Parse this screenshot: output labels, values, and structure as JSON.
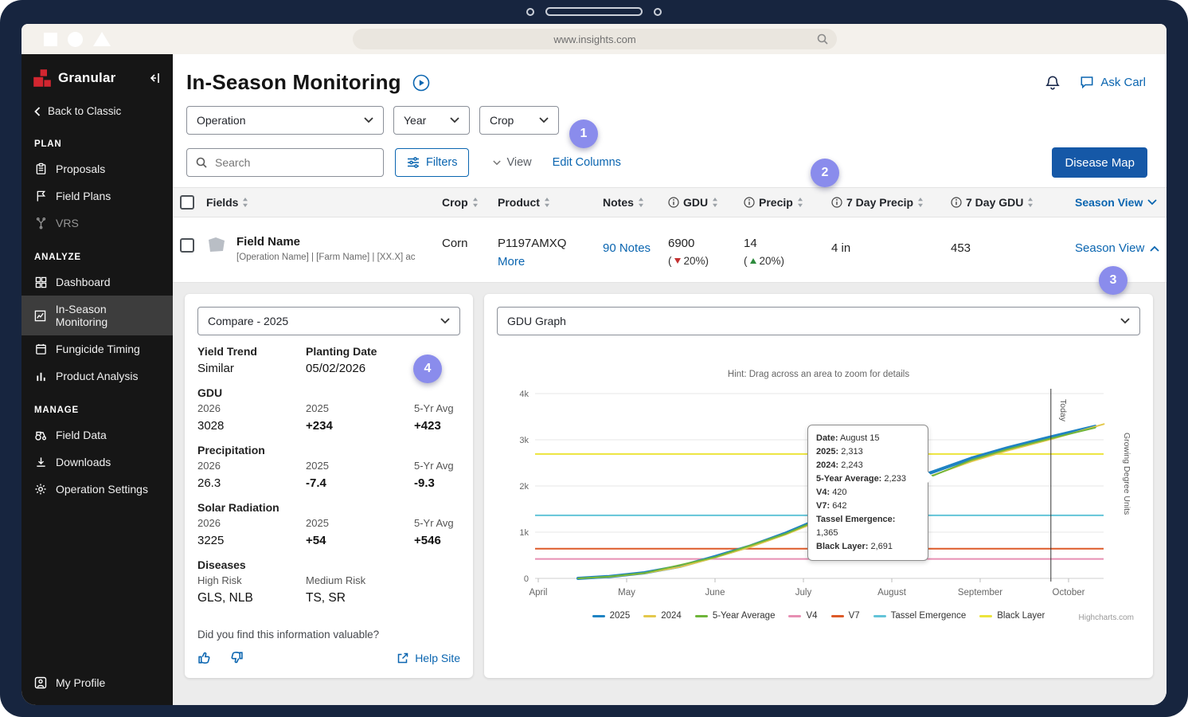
{
  "browser": {
    "url": "www.insights.com"
  },
  "sidebar": {
    "brand": "Granular",
    "back_label": "Back to Classic",
    "section_plan": "PLAN",
    "section_analyze": "ANALYZE",
    "section_manage": "MANAGE",
    "items": {
      "proposals": "Proposals",
      "field_plans": "Field Plans",
      "vrs": "VRS",
      "dashboard": "Dashboard",
      "in_season": "In-Season Monitoring",
      "fungicide": "Fungicide Timing",
      "product_analysis": "Product Analysis",
      "field_data": "Field Data",
      "downloads": "Downloads",
      "operation_settings": "Operation Settings",
      "my_profile": "My Profile"
    }
  },
  "header": {
    "title": "In-Season Monitoring",
    "ask_carl": "Ask Carl"
  },
  "toolbar": {
    "operation": "Operation",
    "year": "Year",
    "crop": "Crop",
    "search_placeholder": "Search",
    "filters": "Filters",
    "view": "View",
    "edit_columns": "Edit Columns",
    "disease_map": "Disease Map"
  },
  "callouts": {
    "one": "1",
    "two": "2",
    "three": "3",
    "four": "4"
  },
  "table": {
    "headers": {
      "fields": "Fields",
      "crop": "Crop",
      "product": "Product",
      "notes": "Notes",
      "gdu": "GDU",
      "precip": "Precip",
      "seven_day_precip": "7 Day Precip",
      "seven_day_gdu": "7 Day GDU",
      "season_view": "Season View"
    },
    "row": {
      "field_name": "Field Name",
      "field_meta": "[Operation Name] | [Farm Name] | [XX.X] ac",
      "crop": "Corn",
      "product": "P1197AMXQ",
      "more": "More",
      "notes": "90 Notes",
      "gdu_value": "6900",
      "paren": "(",
      "gdu_delta": "20%)",
      "precip_value": "14",
      "precip_delta": "20%)",
      "seven_day_precip": "4 in",
      "seven_day_gdu": "453",
      "season_view": "Season View"
    }
  },
  "detail": {
    "compare_select": "Compare - 2025",
    "yield_trend": {
      "label": "Yield Trend",
      "value": "Similar"
    },
    "planting_date": {
      "label": "Planting Date",
      "value": "05/02/2026"
    },
    "col_2026": "2026",
    "col_2025": "2025",
    "col_avg": "5-Yr Avg",
    "gdu": {
      "label": "GDU",
      "v2026": "3028",
      "v2025": "+234",
      "avg": "+423"
    },
    "precipitation": {
      "label": "Precipitation",
      "v2026": "26.3",
      "v2025": "-7.4",
      "avg": "-9.3"
    },
    "solar": {
      "label": "Solar Radiation",
      "v2026": "3225",
      "v2025": "+54",
      "avg": "+546"
    },
    "diseases": {
      "label": "Diseases",
      "high_label": "High Risk",
      "high_value": "GLS, NLB",
      "medium_label": "Medium Risk",
      "medium_value": "TS, SR"
    },
    "feedback_prompt": "Did you find this information valuable?",
    "help_site": "Help Site"
  },
  "chart_data": {
    "type": "line",
    "select_label": "GDU Graph",
    "hint": "Hint: Drag across an area to zoom for details",
    "ylabel": "Growing Degree Units",
    "credit": "Highcharts.com",
    "ylim": [
      0,
      4000
    ],
    "y_ticks": [
      {
        "label": "0",
        "value": 0
      },
      {
        "label": "1k",
        "value": 1000
      },
      {
        "label": "2k",
        "value": 2000
      },
      {
        "label": "3k",
        "value": 3000
      },
      {
        "label": "4k",
        "value": 4000
      }
    ],
    "x_ticks": [
      {
        "label": "April",
        "month": 0
      },
      {
        "label": "May",
        "month": 1
      },
      {
        "label": "June",
        "month": 2
      },
      {
        "label": "July",
        "month": 3
      },
      {
        "label": "August",
        "month": 4
      },
      {
        "label": "September",
        "month": 5
      },
      {
        "label": "October",
        "month": 6
      }
    ],
    "today": {
      "label": "Today",
      "month": 5.8
    },
    "hlines": [
      {
        "name": "V4",
        "value": 420,
        "color": "#e78fb3"
      },
      {
        "name": "V7",
        "value": 642,
        "color": "#dd5a28"
      },
      {
        "name": "Tassel Emergence",
        "value": 1365,
        "color": "#63c4d8"
      },
      {
        "name": "Black Layer",
        "value": 2691,
        "color": "#ece43b"
      }
    ],
    "curves": [
      {
        "name": "2025",
        "color": "#1f83c3",
        "width": 4,
        "points": [
          [
            0.45,
            0
          ],
          [
            0.8,
            40
          ],
          [
            1.2,
            120
          ],
          [
            1.6,
            260
          ],
          [
            2,
            470
          ],
          [
            2.4,
            700
          ],
          [
            2.8,
            980
          ],
          [
            3.2,
            1300
          ],
          [
            3.6,
            1650
          ],
          [
            4,
            2000
          ],
          [
            4.48,
            2313
          ],
          [
            4.9,
            2600
          ],
          [
            5.3,
            2820
          ],
          [
            5.8,
            3060
          ],
          [
            6.3,
            3290
          ]
        ]
      },
      {
        "name": "2024",
        "color": "#e3c84c",
        "width": 2,
        "points": [
          [
            0.45,
            0
          ],
          [
            0.8,
            35
          ],
          [
            1.2,
            110
          ],
          [
            1.6,
            245
          ],
          [
            2,
            450
          ],
          [
            2.4,
            680
          ],
          [
            2.8,
            950
          ],
          [
            3.2,
            1260
          ],
          [
            3.6,
            1600
          ],
          [
            4,
            1950
          ],
          [
            4.48,
            2243
          ],
          [
            4.9,
            2530
          ],
          [
            5.3,
            2760
          ],
          [
            5.8,
            3010
          ],
          [
            6.4,
            3340
          ]
        ]
      },
      {
        "name": "5-Year Average",
        "color": "#6fb53a",
        "width": 2,
        "points": [
          [
            0.45,
            0
          ],
          [
            0.8,
            38
          ],
          [
            1.2,
            115
          ],
          [
            2,
            460
          ],
          [
            2.8,
            965
          ],
          [
            3.6,
            1620
          ],
          [
            4,
            1970
          ],
          [
            4.48,
            2233
          ],
          [
            4.9,
            2560
          ],
          [
            5.3,
            2790
          ],
          [
            5.8,
            3030
          ],
          [
            6.3,
            3260
          ]
        ]
      }
    ],
    "legend": [
      {
        "label": "2025",
        "color": "#1f83c3"
      },
      {
        "label": "2024",
        "color": "#e3c84c"
      },
      {
        "label": "5-Year Average",
        "color": "#6fb53a"
      },
      {
        "label": "V4",
        "color": "#e78fb3"
      },
      {
        "label": "V7",
        "color": "#dd5a28"
      },
      {
        "label": "Tassel Emergence",
        "color": "#63c4d8"
      },
      {
        "label": "Black Layer",
        "color": "#ece43b"
      }
    ],
    "tooltip": {
      "header_label": "Date:",
      "header_value": "August 15",
      "rows": [
        {
          "label": "2025:",
          "value": "2,313"
        },
        {
          "label": "2024:",
          "value": "2,243"
        },
        {
          "label": "5-Year Average:",
          "value": "2,233"
        },
        {
          "label": "V4:",
          "value": "420"
        },
        {
          "label": "V7:",
          "value": "642"
        },
        {
          "label": "Tassel Emergence:",
          "value": "1,365"
        },
        {
          "label": "Black Layer:",
          "value": "2,691"
        }
      ]
    }
  }
}
